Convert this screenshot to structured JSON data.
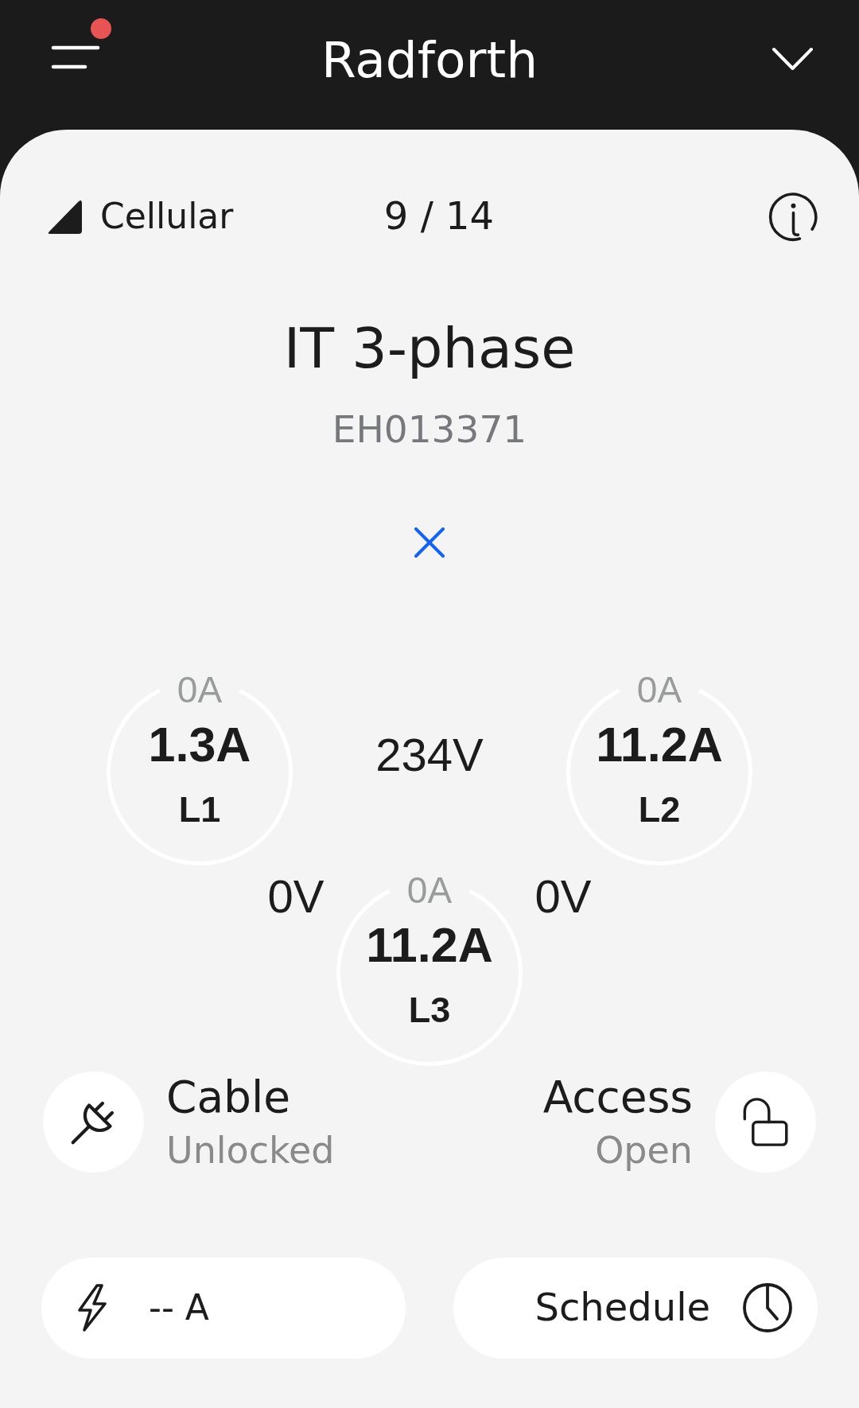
{
  "header": {
    "title": "Radforth",
    "notification_dot": true
  },
  "status_row": {
    "connection": "Cellular",
    "counter": "9 / 14"
  },
  "charger": {
    "name": "IT 3-phase",
    "serial": "EH013371"
  },
  "phases": [
    {
      "limit": "0A",
      "current": "1.3A",
      "label": "L1"
    },
    {
      "limit": "0A",
      "current": "11.2A",
      "label": "L2"
    },
    {
      "limit": "0A",
      "current": "11.2A",
      "label": "L3"
    }
  ],
  "voltages": [
    "234V",
    "0V",
    "0V"
  ],
  "status_items": [
    {
      "kind": "cable",
      "title": "Cable",
      "value": "Unlocked"
    },
    {
      "kind": "access",
      "title": "Access",
      "value": "Open"
    }
  ],
  "actions": [
    {
      "kind": "current",
      "label": "-- A"
    },
    {
      "kind": "schedule",
      "label": "Schedule"
    }
  ]
}
